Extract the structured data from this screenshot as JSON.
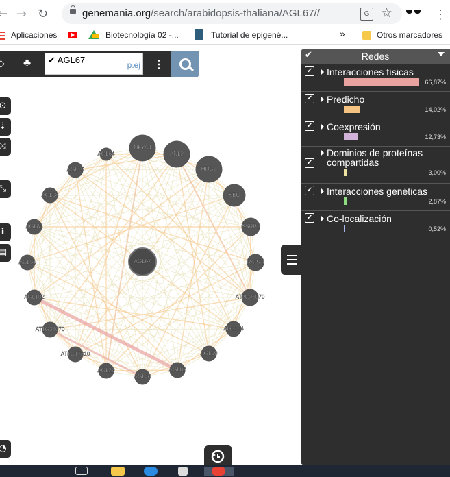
{
  "browser": {
    "url_host": "genemania.org",
    "url_path": "/search/arabidopsis-thaliana/AGL67//",
    "bookmarks": [
      "Aplicaciones",
      "Biotecnología 02 -...",
      "Tutorial de epigené...",
      "»",
      "Otros marcadores"
    ]
  },
  "toolbar": {
    "gene_query": "AGL67",
    "placeholder": "p.ej",
    "more_label": "⋮"
  },
  "network": {
    "center_node": "AGL67",
    "nodes": [
      "AGL64",
      "NFYA3",
      "ANL2",
      "HDG1",
      "SEC",
      "SSRP1",
      "RAP74",
      "AT2G23070",
      "AGL104",
      "AGL59",
      "AGL82",
      "AGL46",
      "AGL29",
      "AT1G17310",
      "AT1G33070",
      "AGL102",
      "AGL51",
      "AGL85",
      "AGL58",
      "AGL75"
    ]
  },
  "panel": {
    "title": "Redes",
    "categories": [
      {
        "label": "Interacciones físicas",
        "percent": "66,87%",
        "value": 66.87,
        "color": "#e8a3a0"
      },
      {
        "label": "Predicho",
        "percent": "14,02%",
        "value": 14.02,
        "color": "#f5c381"
      },
      {
        "label": "Coexpresión",
        "percent": "12,73%",
        "value": 12.73,
        "color": "#d1b1d8"
      },
      {
        "label": "Dominios de proteínas compartidas",
        "percent": "3,00%",
        "value": 3.0,
        "color": "#ede2a0"
      },
      {
        "label": "Interacciones genéticas",
        "percent": "2,87%",
        "value": 2.87,
        "color": "#8fdc80"
      },
      {
        "label": "Co-localización",
        "percent": "0,52%",
        "value": 0.52,
        "color": "#a7b4e8"
      }
    ]
  }
}
